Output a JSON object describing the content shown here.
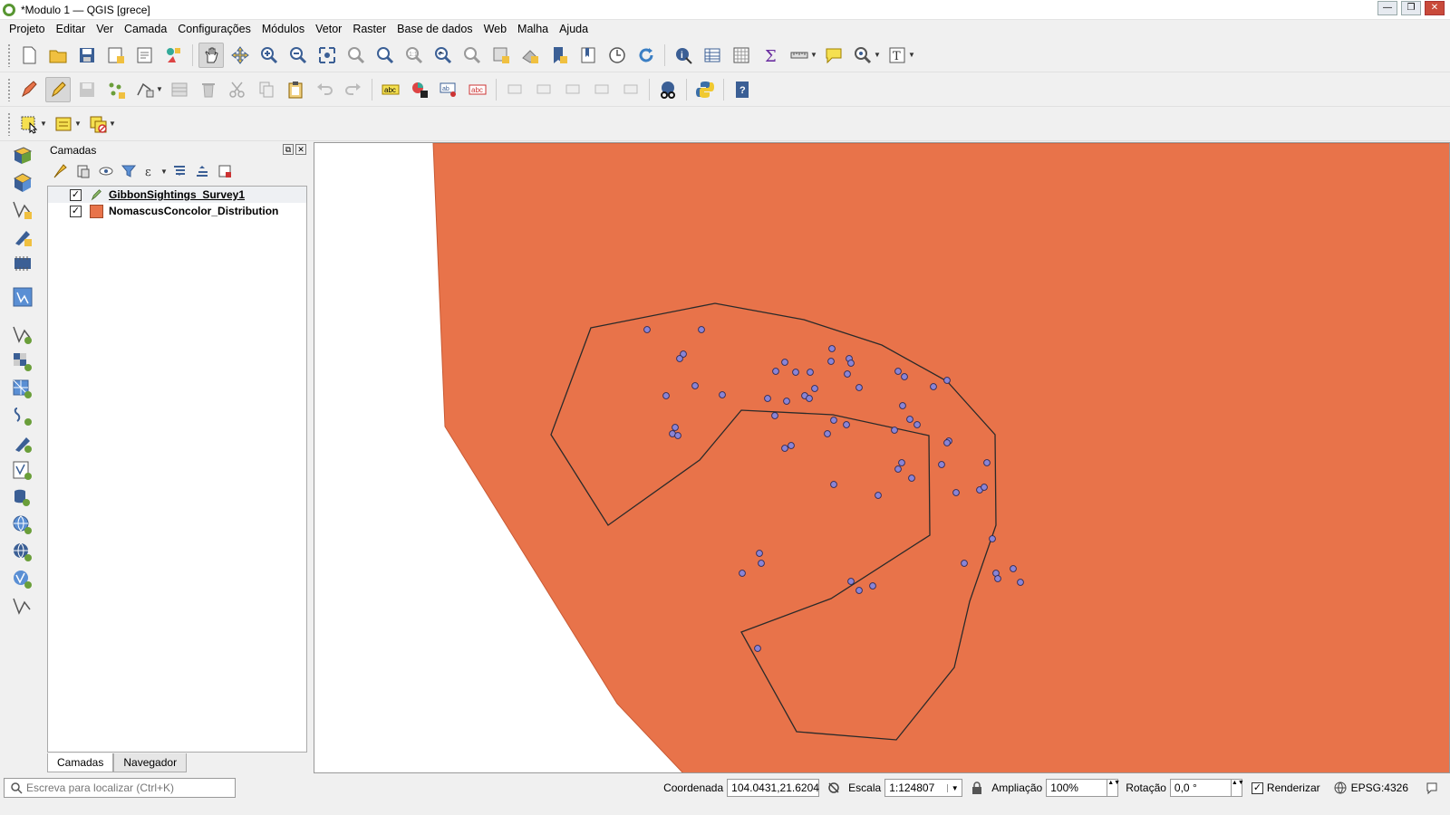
{
  "window": {
    "title": "*Modulo 1 — QGIS [grece]",
    "min": "—",
    "max": "❐",
    "close": "✕"
  },
  "menu": [
    "Projeto",
    "Editar",
    "Ver",
    "Camada",
    "Configurações",
    "Módulos",
    "Vetor",
    "Raster",
    "Base de dados",
    "Web",
    "Malha",
    "Ajuda"
  ],
  "layers_panel": {
    "title": "Camadas",
    "layers": [
      {
        "name": "GibbonSightings_Survey1",
        "checked": true,
        "symbol": "edit-pencil-icon"
      },
      {
        "name": "NomascusConcolor_Distribution",
        "checked": true,
        "symbol": "polygon-fill",
        "color": "#e8734a"
      }
    ],
    "tabs": [
      "Camadas",
      "Navegador"
    ]
  },
  "map": {
    "fill_color": "#e8734a",
    "point_color": "#8a84d6"
  },
  "status": {
    "search_placeholder": "Escreva para localizar (Ctrl+K)",
    "coordinate_label": "Coordenada",
    "coordinate_value": "104.0431,21.6204",
    "scale_label": "Escala",
    "scale_value": "1:124807",
    "magnifier_label": "Ampliação",
    "magnifier_value": "100%",
    "rotation_label": "Rotação",
    "rotation_value": "0,0 °",
    "render_label": "Renderizar",
    "crs": "EPSG:4326",
    "check": "✓",
    "spin": "▲▼"
  }
}
